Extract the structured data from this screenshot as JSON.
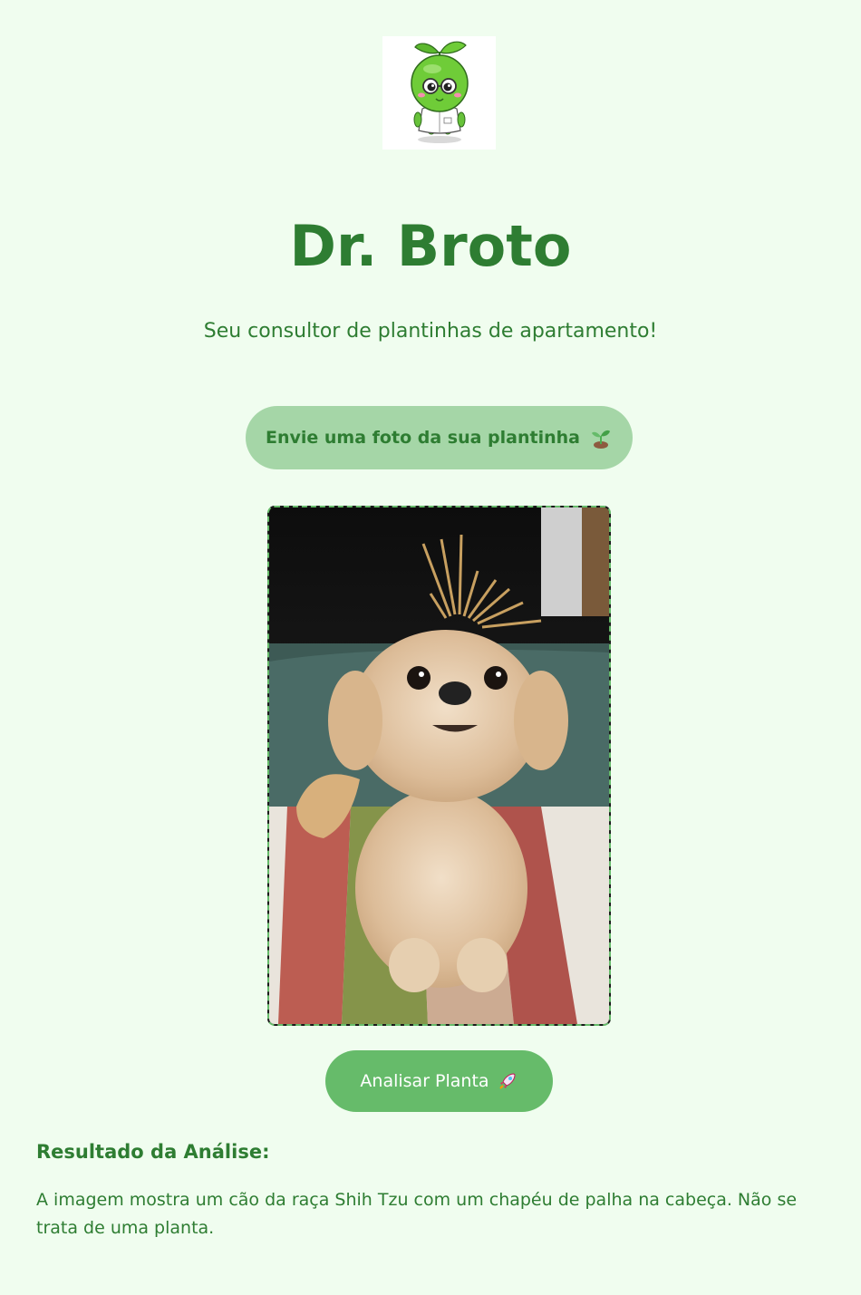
{
  "app": {
    "title": "Dr. Broto",
    "subtitle": "Seu consultor de plantinhas de apartamento!",
    "logo_icon": "sprout-doctor-mascot-icon"
  },
  "upload": {
    "label": "Envie uma foto da sua plantinha",
    "icon": "sprout-icon"
  },
  "preview": {
    "alt": "Uploaded photo preview"
  },
  "analyze": {
    "label": "Analisar Planta",
    "icon": "rocket-icon"
  },
  "result": {
    "heading": "Resultado da Análise:",
    "text": "A imagem mostra um cão da raça Shih Tzu com um chapéu de palha na cabeça. Não se trata de uma planta."
  },
  "colors": {
    "background": "#f0fdef",
    "primary_text": "#2e7d32",
    "upload_button": "#a5d6a7",
    "analyze_button": "#66bb6a",
    "preview_border": "#66bb6a"
  }
}
